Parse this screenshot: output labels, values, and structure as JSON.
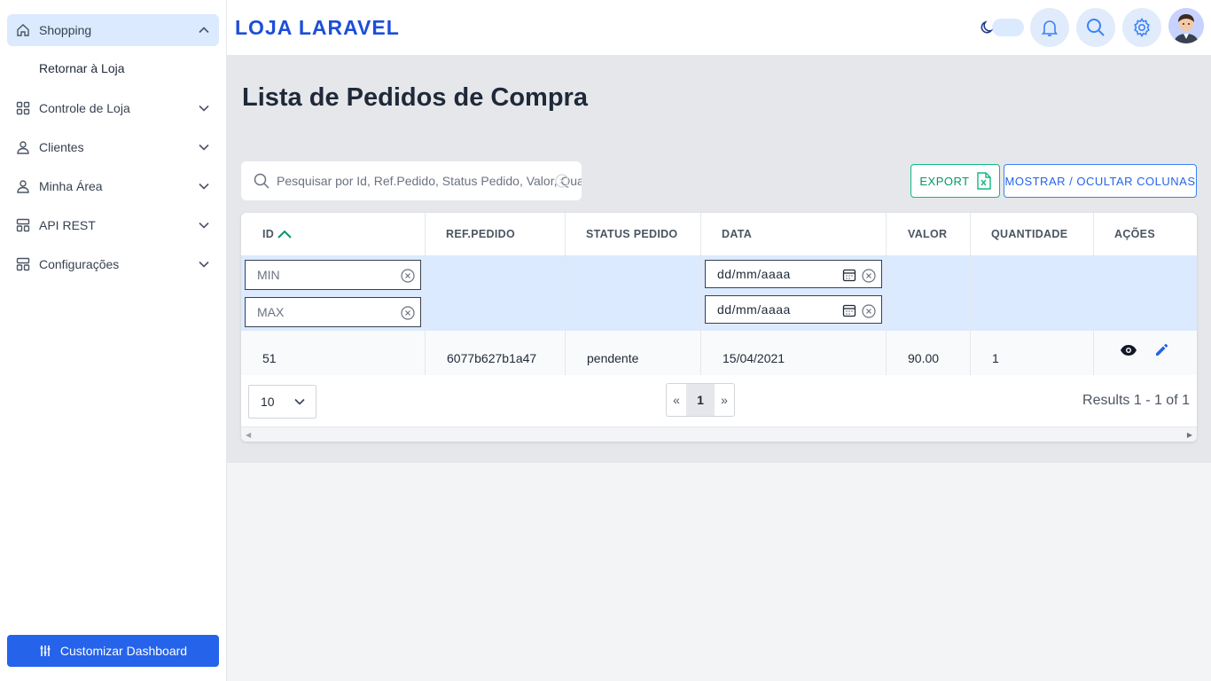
{
  "app": {
    "brand": "LOJA LARAVEL"
  },
  "sidebar": {
    "items": [
      {
        "label": "Shopping",
        "icon": "home-icon",
        "expanded": true
      },
      {
        "label": "Controle de Loja",
        "icon": "grid-icon"
      },
      {
        "label": "Clientes",
        "icon": "user-icon"
      },
      {
        "label": "Minha Área",
        "icon": "user-icon"
      },
      {
        "label": "API REST",
        "icon": "api-icon"
      },
      {
        "label": "Configurações",
        "icon": "settings-icon"
      }
    ],
    "subitem": "Retornar à Loja",
    "customize_label": "Customizar Dashboard"
  },
  "page": {
    "title": "Lista de Pedidos de Compra",
    "search_placeholder": "Pesquisar por Id, Ref.Pedido, Status Pedido, Valor, Quantidade",
    "export_label": "EXPORT",
    "columns_label": "MOSTRAR / OCULTAR COLUNAS"
  },
  "table": {
    "headers": [
      "ID",
      "REF.PEDIDO",
      "STATUS PEDIDO",
      "DATA",
      "VALOR",
      "QUANTIDADE",
      "AÇÕES"
    ],
    "sort_column": "ID",
    "sort_direction": "asc",
    "filters": {
      "min_placeholder": "MIN",
      "max_placeholder": "MAX",
      "date_from": "dd/mm/aaaa",
      "date_to": "dd/mm/aaaa"
    },
    "rows": [
      {
        "id": "51",
        "ref": "6077b627b1a47",
        "status": "pendente",
        "date": "15/04/2021",
        "value": "90.00",
        "qty": "1"
      }
    ],
    "page_size": "10",
    "prev": "«",
    "current_page": "1",
    "next": "»",
    "results_text": "Results 1 - 1 of 1"
  },
  "colors": {
    "primary": "#2563eb",
    "brand": "#1d4ed8",
    "export": "#059669",
    "active_bg": "#dbeafe"
  }
}
